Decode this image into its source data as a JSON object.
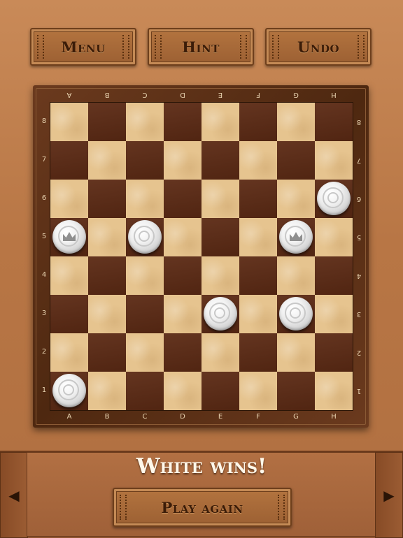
{
  "toolbar": {
    "menu_label": "Menu",
    "hint_label": "Hint",
    "undo_label": "Undo"
  },
  "board": {
    "files_top": [
      "A",
      "B",
      "C",
      "D",
      "E",
      "F",
      "G",
      "H"
    ],
    "files_bottom": [
      "A",
      "B",
      "C",
      "D",
      "E",
      "F",
      "G",
      "H"
    ],
    "ranks": [
      "8",
      "7",
      "6",
      "5",
      "4",
      "3",
      "2",
      "1"
    ],
    "light_square_color": "#e6c48f",
    "dark_square_color": "#5c2a14",
    "pieces": [
      {
        "square": "H6",
        "color": "white",
        "type": "man"
      },
      {
        "square": "A5",
        "color": "white",
        "type": "king"
      },
      {
        "square": "C5",
        "color": "white",
        "type": "man"
      },
      {
        "square": "G5",
        "color": "white",
        "type": "king"
      },
      {
        "square": "E3",
        "color": "white",
        "type": "man"
      },
      {
        "square": "G3",
        "color": "white",
        "type": "man"
      },
      {
        "square": "A1",
        "color": "white",
        "type": "man"
      }
    ]
  },
  "status": {
    "message": "White wins!"
  },
  "actions": {
    "play_again_label": "Play again"
  },
  "icons": {
    "left_arrow": "left-arrow-icon",
    "right_arrow": "right-arrow-icon",
    "king_crown": "crown-icon"
  }
}
